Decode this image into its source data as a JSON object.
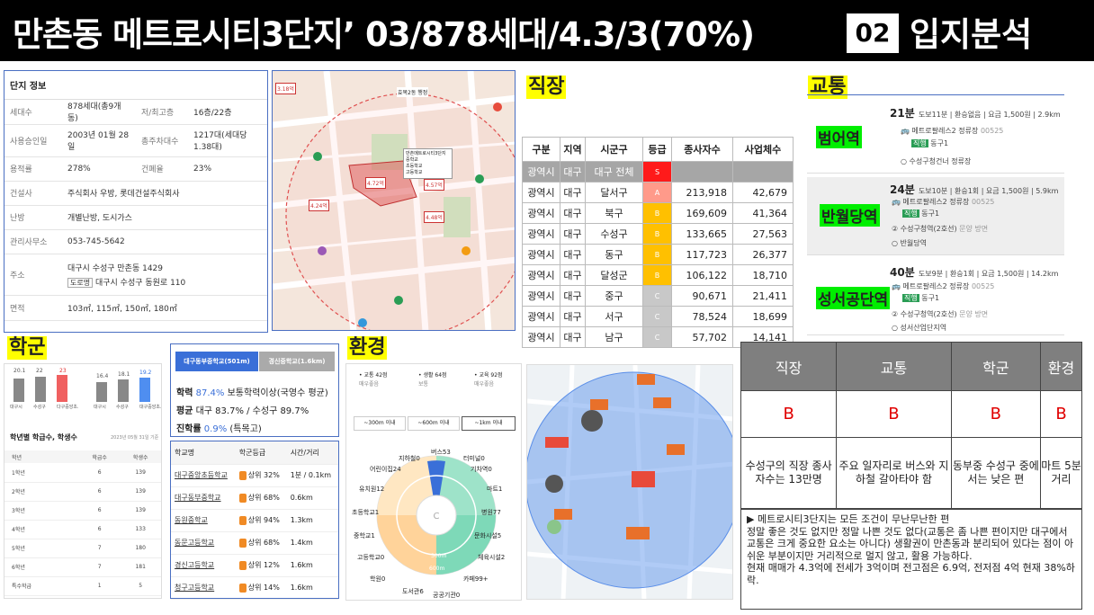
{
  "header": {
    "title": "만촌동 메트로시티3단지’ 03/878세대/4.3/3(70%)",
    "badge": "02",
    "section": "입지분석"
  },
  "complex": {
    "title": "단지 정보",
    "rows": [
      {
        "k1": "세대수",
        "v1": "878세대(총9개동)",
        "k2": "저/최고층",
        "v2": "16층/22층"
      },
      {
        "k1": "사용승인일",
        "v1": "2003년 01월 28일",
        "k2": "총주차대수",
        "v2": "1217대(세대당 1.38대)"
      },
      {
        "k1": "용적률",
        "v1": "278%",
        "k2": "건폐율",
        "v2": "23%"
      },
      {
        "k1": "건설사",
        "v1": "주식회사 우방, 롯데건설주식회사"
      },
      {
        "k1": "난방",
        "v1": "개별난방, 도시가스"
      },
      {
        "k1": "관리사무소",
        "v1": "053-745-5642"
      },
      {
        "k1": "주소",
        "v1": "대구시 수성구 만촌동 1429",
        "tag": "도로명",
        "v1b": "대구시 수성구 동원로 110"
      },
      {
        "k1": "면적",
        "v1": "103㎡, 115㎡, 150㎡, 180㎡"
      }
    ]
  },
  "map1": {
    "place": "효목2동 행정",
    "labels": [
      "4.24억",
      "4.72억",
      "4.48억",
      "4.57억",
      "3.18억"
    ],
    "popup": [
      "만촌메트로시티3단지",
      "중학교",
      "초등학교",
      "고등학교"
    ]
  },
  "jobs": {
    "title": "직장",
    "headers": [
      "구분",
      "지역",
      "시군구",
      "등급",
      "종사자수",
      "사업체수"
    ],
    "rows": [
      [
        "광역시",
        "대구",
        "대구 전체",
        "S",
        "",
        ""
      ],
      [
        "광역시",
        "대구",
        "달서구",
        "A",
        "213,918",
        "42,679"
      ],
      [
        "광역시",
        "대구",
        "북구",
        "B",
        "169,609",
        "41,364"
      ],
      [
        "광역시",
        "대구",
        "수성구",
        "B",
        "133,665",
        "27,563"
      ],
      [
        "광역시",
        "대구",
        "동구",
        "B",
        "117,723",
        "26,377"
      ],
      [
        "광역시",
        "대구",
        "달성군",
        "B",
        "106,122",
        "18,710"
      ],
      [
        "광역시",
        "대구",
        "중구",
        "C",
        "90,671",
        "21,411"
      ],
      [
        "광역시",
        "대구",
        "서구",
        "C",
        "78,524",
        "18,699"
      ],
      [
        "광역시",
        "대구",
        "남구",
        "C",
        "57,702",
        "14,141"
      ]
    ],
    "grade_colors": {
      "S": "#ff1a1a",
      "A": "#ff9a8a",
      "B": "#ffc000",
      "C": "#c8c8c8"
    }
  },
  "transport": {
    "title": "교통",
    "stations": [
      {
        "name": "범어역",
        "min": "21분",
        "meta": "도보11분 | 환승없음 | 요금 1,500원 | 2.9km",
        "l1": "메트로팔레스2 정류장",
        "code": "00525",
        "bus": "동구1",
        "l2": "수성구청건너 정류장"
      },
      {
        "name": "반월당역",
        "min": "24분",
        "meta": "도보10분 | 환승1회 | 요금 1,500원 | 5.9km",
        "l1": "메트로팔레스2 정류장",
        "code": "00525",
        "bus": "동구1",
        "l2": "수성구청역(2호선)",
        "l2b": "문양 방면",
        "l3": "반월당역"
      },
      {
        "name": "성서공단역",
        "min": "40분",
        "meta": "도보9분 | 환승1회 | 요금 1,500원 | 14.2km",
        "l1": "메트로팔레스2 정류장",
        "code": "00525",
        "bus": "동구1",
        "l2": "수성구청역(2호선)",
        "l2b": "문양 방면",
        "l3": "성서산업단지역"
      }
    ]
  },
  "school": {
    "title": "학군",
    "bars": [
      {
        "v": "20.1",
        "l": "대구시"
      },
      {
        "v": "22",
        "l": "수성구"
      },
      {
        "v": "23",
        "l": "다구중앙초..."
      },
      {
        "v": "16.4",
        "l": "대구시"
      },
      {
        "v": "18.1",
        "l": "수성구"
      },
      {
        "v": "19.2",
        "l": "대구중앙초..."
      }
    ],
    "grade_title": "학년별 학급수, 학생수",
    "date": "2023년 05월 31일 기준",
    "grade_headers": [
      "학년",
      "학급수",
      "학생수"
    ],
    "grades": [
      [
        "1학년",
        "6",
        "139"
      ],
      [
        "2학년",
        "6",
        "139"
      ],
      [
        "3학년",
        "6",
        "139"
      ],
      [
        "4학년",
        "6",
        "133"
      ],
      [
        "5학년",
        "7",
        "180"
      ],
      [
        "6학년",
        "7",
        "181"
      ],
      [
        "특수학급",
        "1",
        "5"
      ]
    ],
    "tab1": "대구동부중학교(501m)",
    "tab2": "경신중학교(1.6km)",
    "s1_label": "학력",
    "s1_pct": "87.4%",
    "s1_rest": "보통학력이상(국영수 평균)",
    "s2_label": "평균",
    "s2_rest": "대구 83.7% / 수성구 89.7%",
    "s3_label": "진학률",
    "s3_pct": "0.9%",
    "s3_rest": "(특목고)",
    "list_headers": [
      "학교명",
      "학군등급",
      "시간/거리"
    ],
    "list": [
      [
        "대구중앙초등학교",
        "상위 32%",
        "1분 / 0.1km"
      ],
      [
        "대구동부중학교",
        "상위 68%",
        "0.6km"
      ],
      [
        "동원중학교",
        "상위 94%",
        "1.3km"
      ],
      [
        "동문고등학교",
        "상위 68%",
        "1.4km"
      ],
      [
        "경신고등학교",
        "상위 12%",
        "1.6km"
      ],
      [
        "청구고등학교",
        "상위 14%",
        "1.6km"
      ]
    ]
  },
  "env": {
    "title": "환경",
    "tabs": [
      {
        "a": "• 교통 42점",
        "b": "매우좋음"
      },
      {
        "a": "• 생활 64점",
        "b": "보통"
      },
      {
        "a": "• 교육 92점",
        "b": "매우좋음"
      }
    ],
    "ranges": [
      "~300m 이내",
      "~600m 이내",
      "~1km 이내"
    ],
    "rings": [
      "300m",
      "600m",
      "1km"
    ],
    "labels": [
      "지하철0",
      "버스53",
      "터미널0",
      "어린이집24",
      "기차역0",
      "유치원12",
      "마트1",
      "초등학교1",
      "병원77",
      "중학교1",
      "문화시설5",
      "고등학교0",
      "체육시설2",
      "학원0",
      "카페99+",
      "도서관6",
      "공공기관0"
    ]
  },
  "summary": {
    "headers": [
      "직장",
      "교통",
      "학군",
      "환경"
    ],
    "grades": [
      "B",
      "B",
      "B",
      "B"
    ],
    "descs": [
      "수성구의 직장 종사자수는 13만명",
      "주요 일자리로 버스와 지하철 갈아타야 함",
      "동부중 수성구 중에서는 낮은 편",
      "마트 5분거리"
    ]
  },
  "note": {
    "lines": [
      "▶ 메트로시티3단지는  모든 조건이 무난무난한  편",
      "정말 좋은 것도 없지만 정말 나쁜 것도 없다(교통은 좀 나쁜 편이지만 대구에서 교통은 크게 중요한 요소는 아니다) 생활권이 만촌동과 분리되어 있다는 점이 아쉬운 부분이지만 거리적으로 멀지 않고, 활용 가능하다.",
      "현재 매매가 4.3억에 전세가 3억이며 전고점은 6.9억, 전저점 4억 현재 38%하락."
    ]
  }
}
